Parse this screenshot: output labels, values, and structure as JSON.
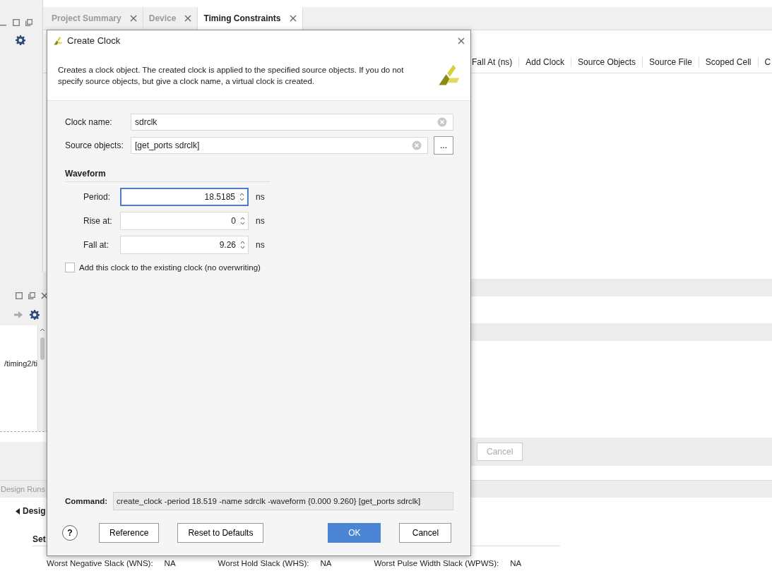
{
  "editor_tabs": [
    {
      "label": "Project Summary",
      "selected": false
    },
    {
      "label": "Device",
      "selected": false
    },
    {
      "label": "Timing Constraints",
      "selected": true
    }
  ],
  "table": {
    "columns": [
      "Fall At (ns)",
      "Add Clock",
      "Source Objects",
      "Source File",
      "Scoped Cell",
      "C"
    ]
  },
  "background_button": {
    "label": "Cancel",
    "disabled": true
  },
  "sources_panel": {
    "path": "/timing2/ti"
  },
  "design_runs": {
    "tab": "Design Runs",
    "tree_item": "Desig",
    "section": "Set"
  },
  "summary": [
    {
      "label": "Worst Negative Slack (WNS):",
      "value": "NA"
    },
    {
      "label": "Worst Hold Slack (WHS):",
      "value": "NA"
    },
    {
      "label": "Worst Pulse Width Slack (WPWS):",
      "value": "NA"
    }
  ],
  "dialog": {
    "title": "Create Clock",
    "description": "Creates a clock object. The created clock is applied to the specified source objects. If you do not specify source objects, but give a clock name, a virtual clock is created.",
    "fields": [
      {
        "label": "Clock name:",
        "value": "sdrclk",
        "browse": false
      },
      {
        "label": "Source objects:",
        "value": "[get_ports sdrclk]",
        "browse": true,
        "browse_label": "..."
      }
    ],
    "waveform": {
      "title": "Waveform",
      "rows": [
        {
          "label": "Period:",
          "value": "18.5185",
          "unit": "ns",
          "focused": true
        },
        {
          "label": "Rise at:",
          "value": "0",
          "unit": "ns",
          "focused": false
        },
        {
          "label": "Fall at:",
          "value": "9.26",
          "unit": "ns",
          "focused": false
        }
      ]
    },
    "add_to_existing": {
      "label": "Add this clock to the existing clock (no overwriting)",
      "checked": false
    },
    "command": {
      "label": "Command:",
      "value": "create_clock -period 18.519 -name sdrclk -waveform {0.000 9.260} [get_ports sdrclk]"
    },
    "help": "?",
    "buttons": [
      {
        "label": "Reference",
        "kind": "normal"
      },
      {
        "label": "Reset to Defaults",
        "kind": "normal"
      },
      {
        "label": "OK",
        "kind": "primary"
      },
      {
        "label": "Cancel",
        "kind": "normal"
      }
    ]
  }
}
